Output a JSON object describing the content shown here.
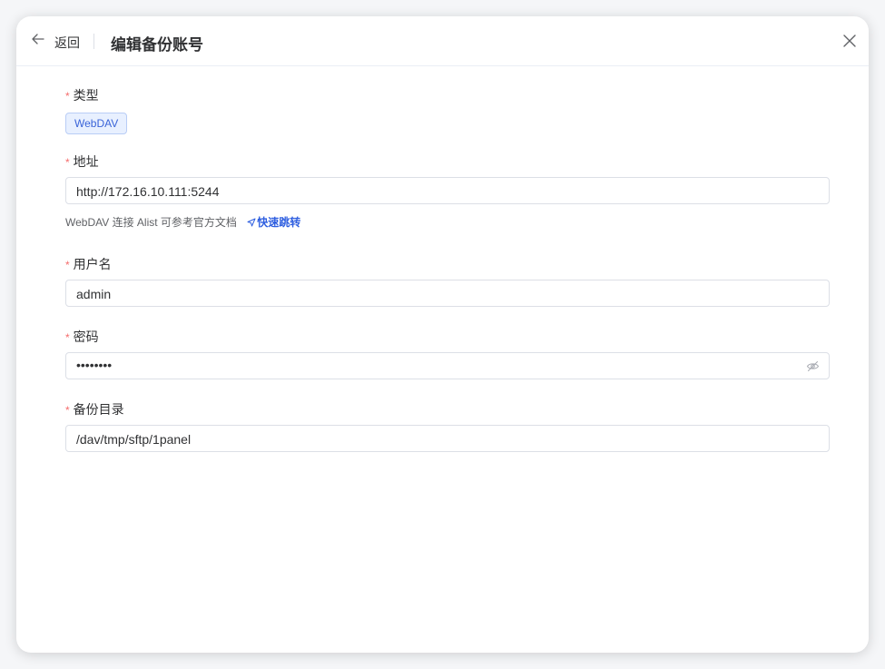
{
  "header": {
    "back_label": "返回",
    "title": "编辑备份账号"
  },
  "form": {
    "type": {
      "label": "类型",
      "value": "WebDAV"
    },
    "address": {
      "label": "地址",
      "value": "http://172.16.10.111:5244",
      "helper": "WebDAV 连接 Alist 可参考官方文档",
      "link_label": "快速跳转"
    },
    "username": {
      "label": "用户名",
      "value": "admin"
    },
    "password": {
      "label": "密码",
      "value": "••••••••"
    },
    "backup_dir": {
      "label": "备份目录",
      "value": "/dav/tmp/sftp/1panel"
    }
  },
  "required_mark": "*",
  "colors": {
    "accent": "#2f5fe0",
    "tag_bg": "#e8f0ff",
    "required": "#f56c6c"
  },
  "icons": [
    "arrow-left-icon",
    "close-icon",
    "send-icon",
    "eye-off-icon"
  ]
}
